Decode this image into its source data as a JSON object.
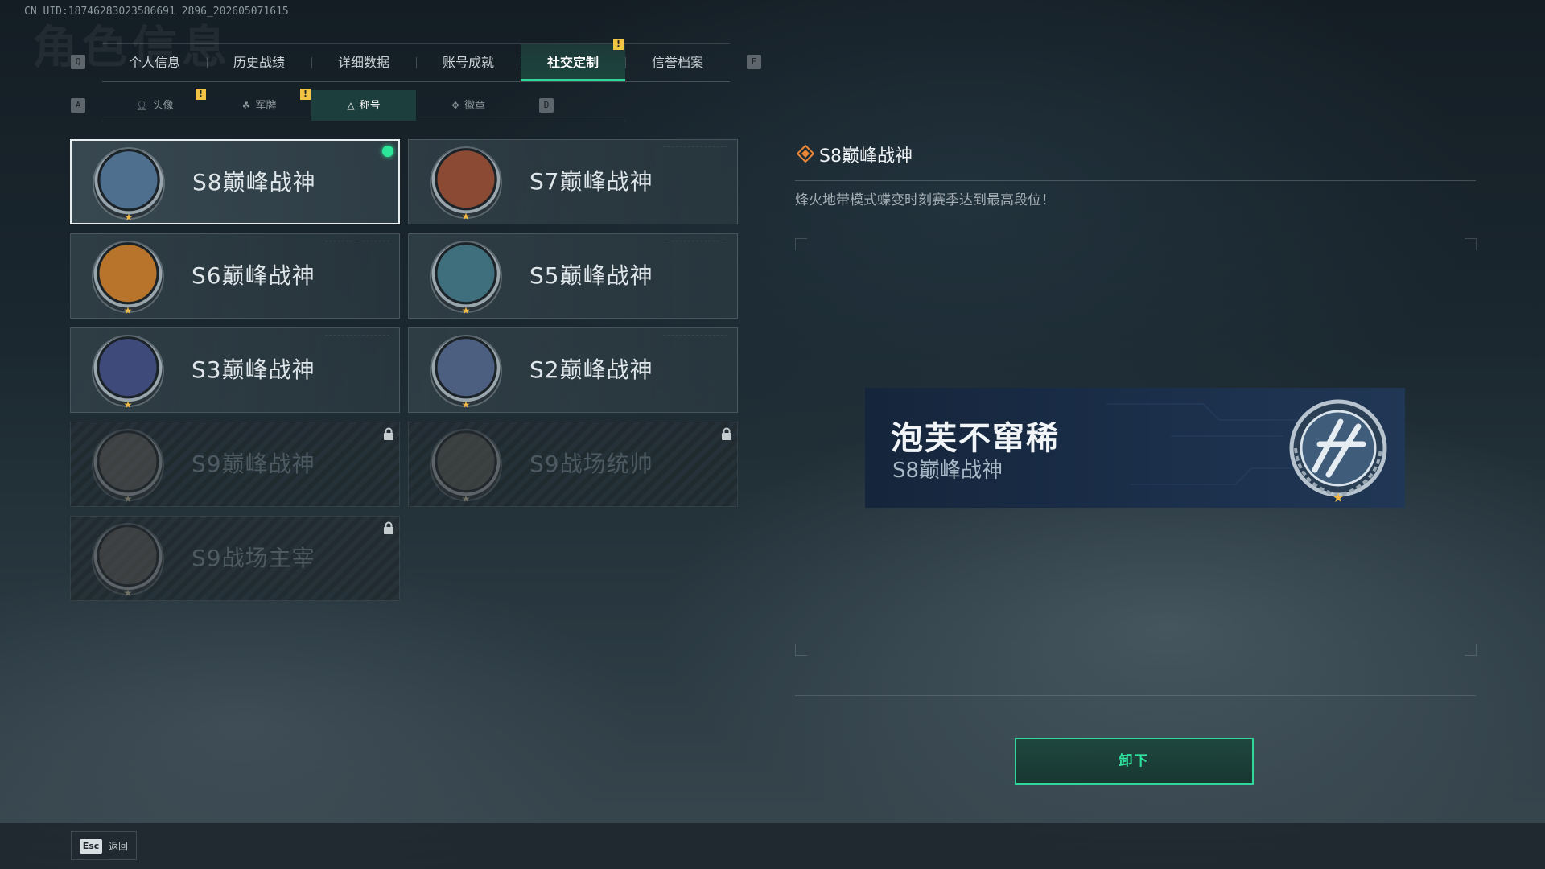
{
  "uid_text": "CN UID:18746283023586691 2896_202605071615",
  "background_title": "角色信息",
  "tabs": {
    "left_key": "Q",
    "right_key": "E",
    "items": [
      {
        "label": "个人信息"
      },
      {
        "label": "历史战绩"
      },
      {
        "label": "详细数据"
      },
      {
        "label": "账号成就"
      },
      {
        "label": "社交定制"
      },
      {
        "label": "信誉档案"
      }
    ],
    "active_index": 4
  },
  "subtabs": {
    "left_key": "A",
    "right_key": "D",
    "items": [
      {
        "label": "头像",
        "icon": "person-icon"
      },
      {
        "label": "军牌",
        "icon": "tag-icon"
      },
      {
        "label": "称号",
        "icon": "triangle-icon"
      },
      {
        "label": "徽章",
        "icon": "badge-icon"
      }
    ],
    "active_index": 2
  },
  "alert_glyph": "!",
  "titles": [
    {
      "name": "S8巅峰战神",
      "status": "equipped",
      "badge_color": "#4f6f8f"
    },
    {
      "name": "S7巅峰战神",
      "status": "owned",
      "badge_color": "#8a4a34"
    },
    {
      "name": "S6巅峰战神",
      "status": "owned",
      "badge_color": "#b8742a"
    },
    {
      "name": "S5巅峰战神",
      "status": "owned",
      "badge_color": "#3f6e7d"
    },
    {
      "name": "S3巅峰战神",
      "status": "owned",
      "badge_color": "#3e4a7a"
    },
    {
      "name": "S2巅峰战神",
      "status": "owned",
      "badge_color": "#4d5f80"
    },
    {
      "name": "S9巅峰战神",
      "status": "locked",
      "badge_color": "#6b5b48"
    },
    {
      "name": "S9战场统帅",
      "status": "locked",
      "badge_color": "#5f5545"
    },
    {
      "name": "S9战场主宰",
      "status": "locked",
      "badge_color": "#6a5644"
    }
  ],
  "detail": {
    "title": "S8巅峰战神",
    "description": "烽火地带模式蝶变时刻赛季达到最高段位！"
  },
  "banner": {
    "player_name": "泡芙不窜稀",
    "title": "S8巅峰战神"
  },
  "unequip_label": "卸下",
  "back": {
    "key": "Esc",
    "label": "返回"
  },
  "colors": {
    "accent": "#2fd79a",
    "warning": "#f2c443",
    "star": "#f0b845"
  }
}
